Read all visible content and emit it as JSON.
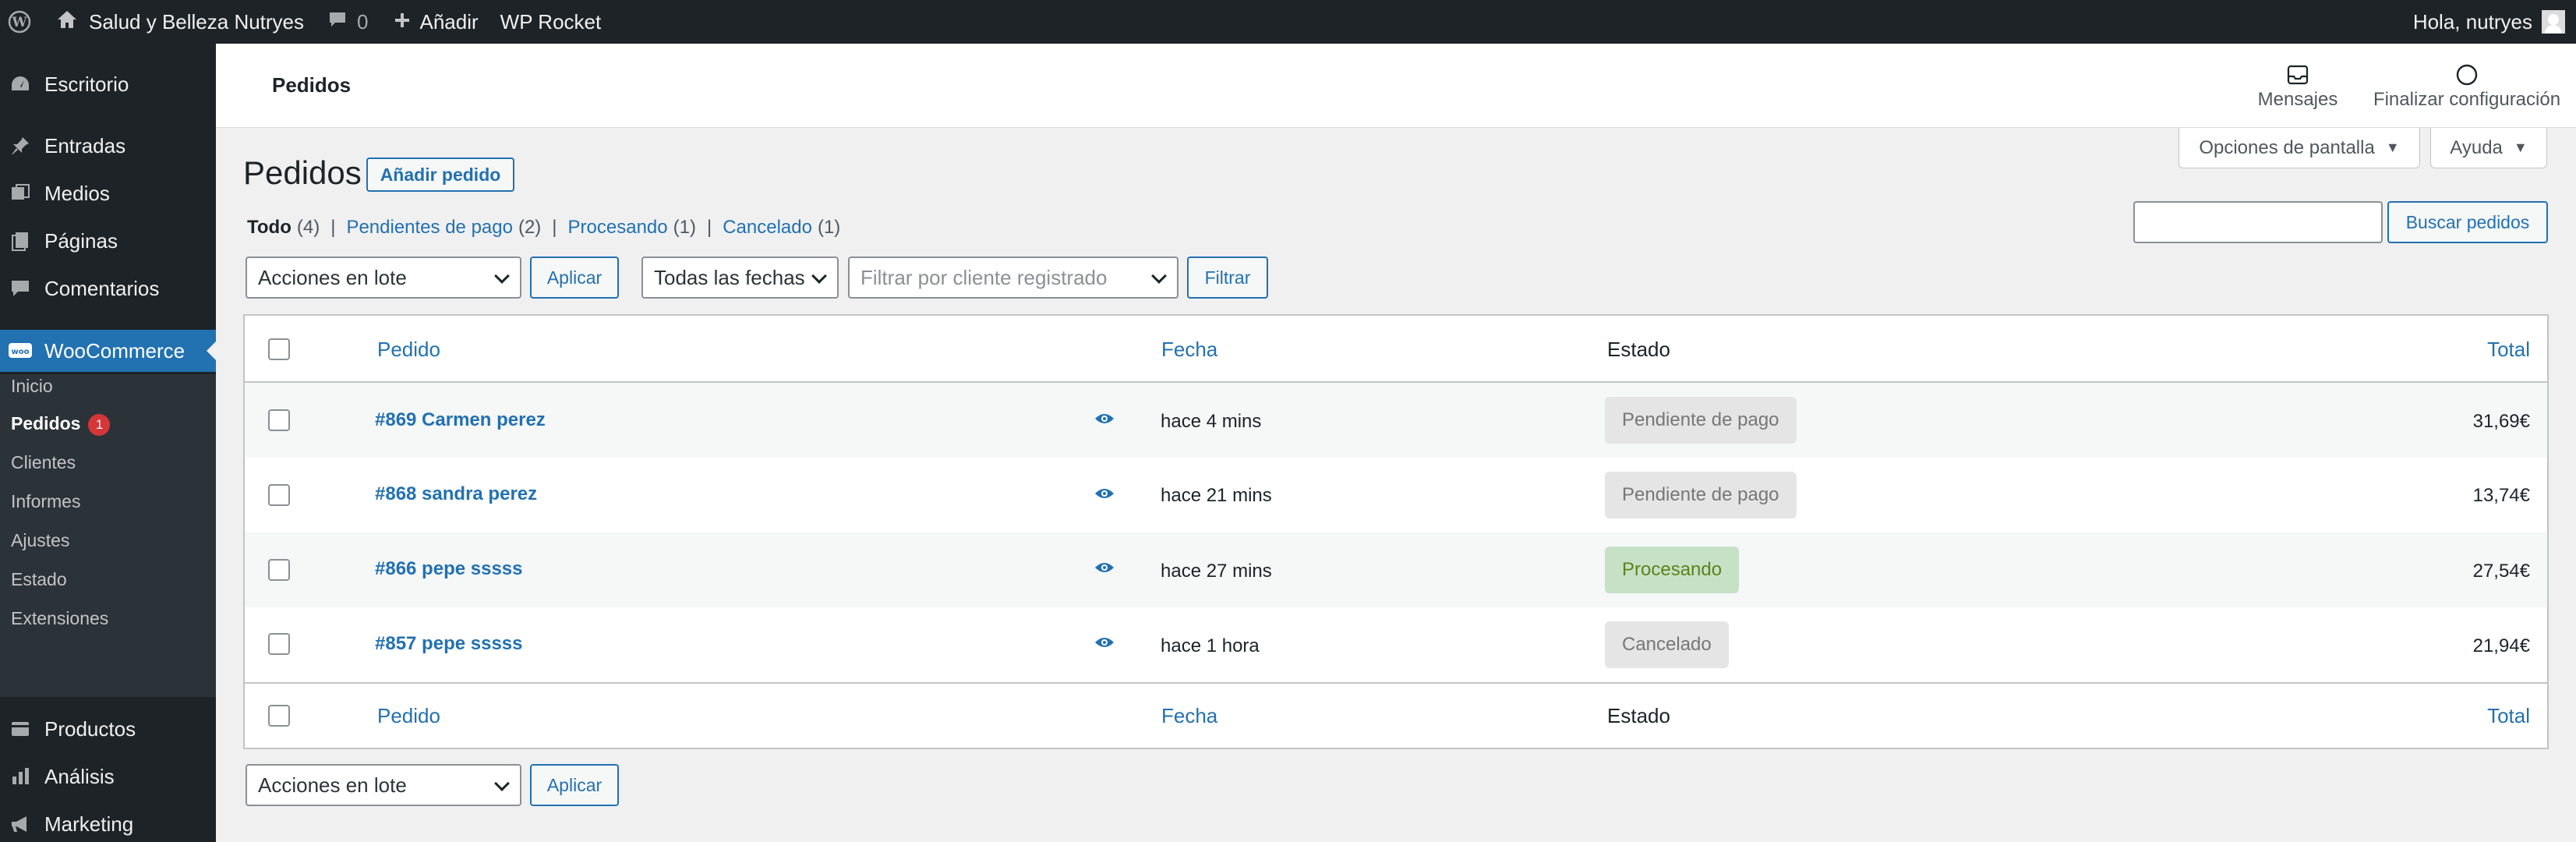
{
  "adminbar": {
    "site_name": "Salud y Belleza Nutryes",
    "comments_count": "0",
    "new_label": "Añadir",
    "rocket_label": "WP Rocket",
    "greeting": "Hola, nutryes"
  },
  "sidebar": {
    "items": [
      {
        "label": "Escritorio",
        "icon": "dashboard-icon"
      },
      {
        "label": "Entradas",
        "icon": "pin-icon"
      },
      {
        "label": "Medios",
        "icon": "media-icon"
      },
      {
        "label": "Páginas",
        "icon": "pages-icon"
      },
      {
        "label": "Comentarios",
        "icon": "comments-icon"
      },
      {
        "label": "WooCommerce",
        "icon": "woo-icon"
      },
      {
        "label": "Productos",
        "icon": "products-icon"
      },
      {
        "label": "Análisis",
        "icon": "analytics-icon"
      },
      {
        "label": "Marketing",
        "icon": "megaphone-icon"
      }
    ],
    "submenu": [
      {
        "label": "Inicio"
      },
      {
        "label": "Pedidos",
        "badge": "1"
      },
      {
        "label": "Clientes"
      },
      {
        "label": "Informes"
      },
      {
        "label": "Ajustes"
      },
      {
        "label": "Estado"
      },
      {
        "label": "Extensiones"
      }
    ]
  },
  "header": {
    "title": "Pedidos",
    "messages_label": "Mensajes",
    "finish_setup_label": "Finalizar configuración"
  },
  "screen_tabs": {
    "options_label": "Opciones de pantalla",
    "help_label": "Ayuda"
  },
  "page": {
    "title": "Pedidos",
    "add_button": "Añadir pedido",
    "search_button": "Buscar pedidos",
    "search_value": ""
  },
  "views": [
    {
      "label": "Todo",
      "count": "(4)"
    },
    {
      "label": "Pendientes de pago",
      "count": "(2)"
    },
    {
      "label": "Procesando",
      "count": "(1)"
    },
    {
      "label": "Cancelado",
      "count": "(1)"
    }
  ],
  "filters": {
    "bulk_actions": "Acciones en lote",
    "apply": "Aplicar",
    "dates": "Todas las fechas",
    "customer_placeholder": "Filtrar por cliente registrado",
    "filter": "Filtrar"
  },
  "table": {
    "columns": {
      "order": "Pedido",
      "date": "Fecha",
      "status": "Estado",
      "total": "Total"
    },
    "rows": [
      {
        "order": "#869 Carmen perez",
        "date": "hace 4 mins",
        "status": "Pendiente de pago",
        "status_type": "pending",
        "total": "31,69€"
      },
      {
        "order": "#868 sandra perez",
        "date": "hace 21 mins",
        "status": "Pendiente de pago",
        "status_type": "pending",
        "total": "13,74€"
      },
      {
        "order": "#866 pepe sssss",
        "date": "hace 27 mins",
        "status": "Procesando",
        "status_type": "processing",
        "total": "27,54€"
      },
      {
        "order": "#857 pepe sssss",
        "date": "hace 1 hora",
        "status": "Cancelado",
        "status_type": "cancelled",
        "total": "21,94€"
      }
    ]
  },
  "bottom": {
    "bulk_actions": "Acciones en lote",
    "apply": "Aplicar"
  },
  "colors": {
    "accent": "#2271b1",
    "adminbar": "#1d2327",
    "processing_bg": "#c6e1c6",
    "pending_bg": "#e5e5e5"
  }
}
